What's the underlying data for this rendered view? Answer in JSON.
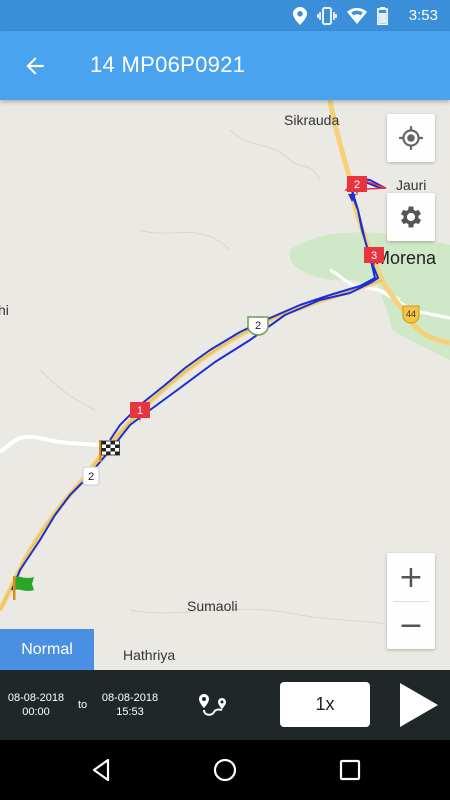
{
  "status_bar": {
    "time": "3:53",
    "icons": [
      "location-pin-icon",
      "vibrate-icon",
      "wifi-icon",
      "battery-icon"
    ]
  },
  "app_bar": {
    "title": "14 MP06P0921",
    "back_icon": "arrow-back-icon"
  },
  "map": {
    "labels": {
      "sikrauda": "Sikrauda",
      "jauri": "Jauri",
      "morena": "Morena",
      "sumaoli": "Sumaoli",
      "hathriya": "Hathriya",
      "partial_left": "hi"
    },
    "route_shields": {
      "highway_44": "44",
      "route_2_upper": "2",
      "route_2_lower": "2"
    },
    "markers": [
      {
        "label": "1",
        "color": "#e8343f"
      },
      {
        "label": "2",
        "color": "#e8343f"
      },
      {
        "label": "3",
        "color": "#e8343f"
      }
    ],
    "track_color": "#1a2fd6",
    "start_marker": "green-flag-icon",
    "end_marker": "checkered-flag-icon",
    "buttons": {
      "locate": "my-location-icon",
      "settings": "gear-icon",
      "zoom_in": "+",
      "zoom_out": "−"
    },
    "map_type_label": "Normal"
  },
  "controls": {
    "from_date": "08-08-2018",
    "from_time": "00:00",
    "to_label": "to",
    "to_date": "08-08-2018",
    "to_time": "15:53",
    "route_icon": "route-icon",
    "speed_label": "1x",
    "play_icon": "play-icon"
  },
  "nav_bar": {
    "back": "nav-back-icon",
    "home": "nav-home-icon",
    "recents": "nav-recents-icon"
  }
}
